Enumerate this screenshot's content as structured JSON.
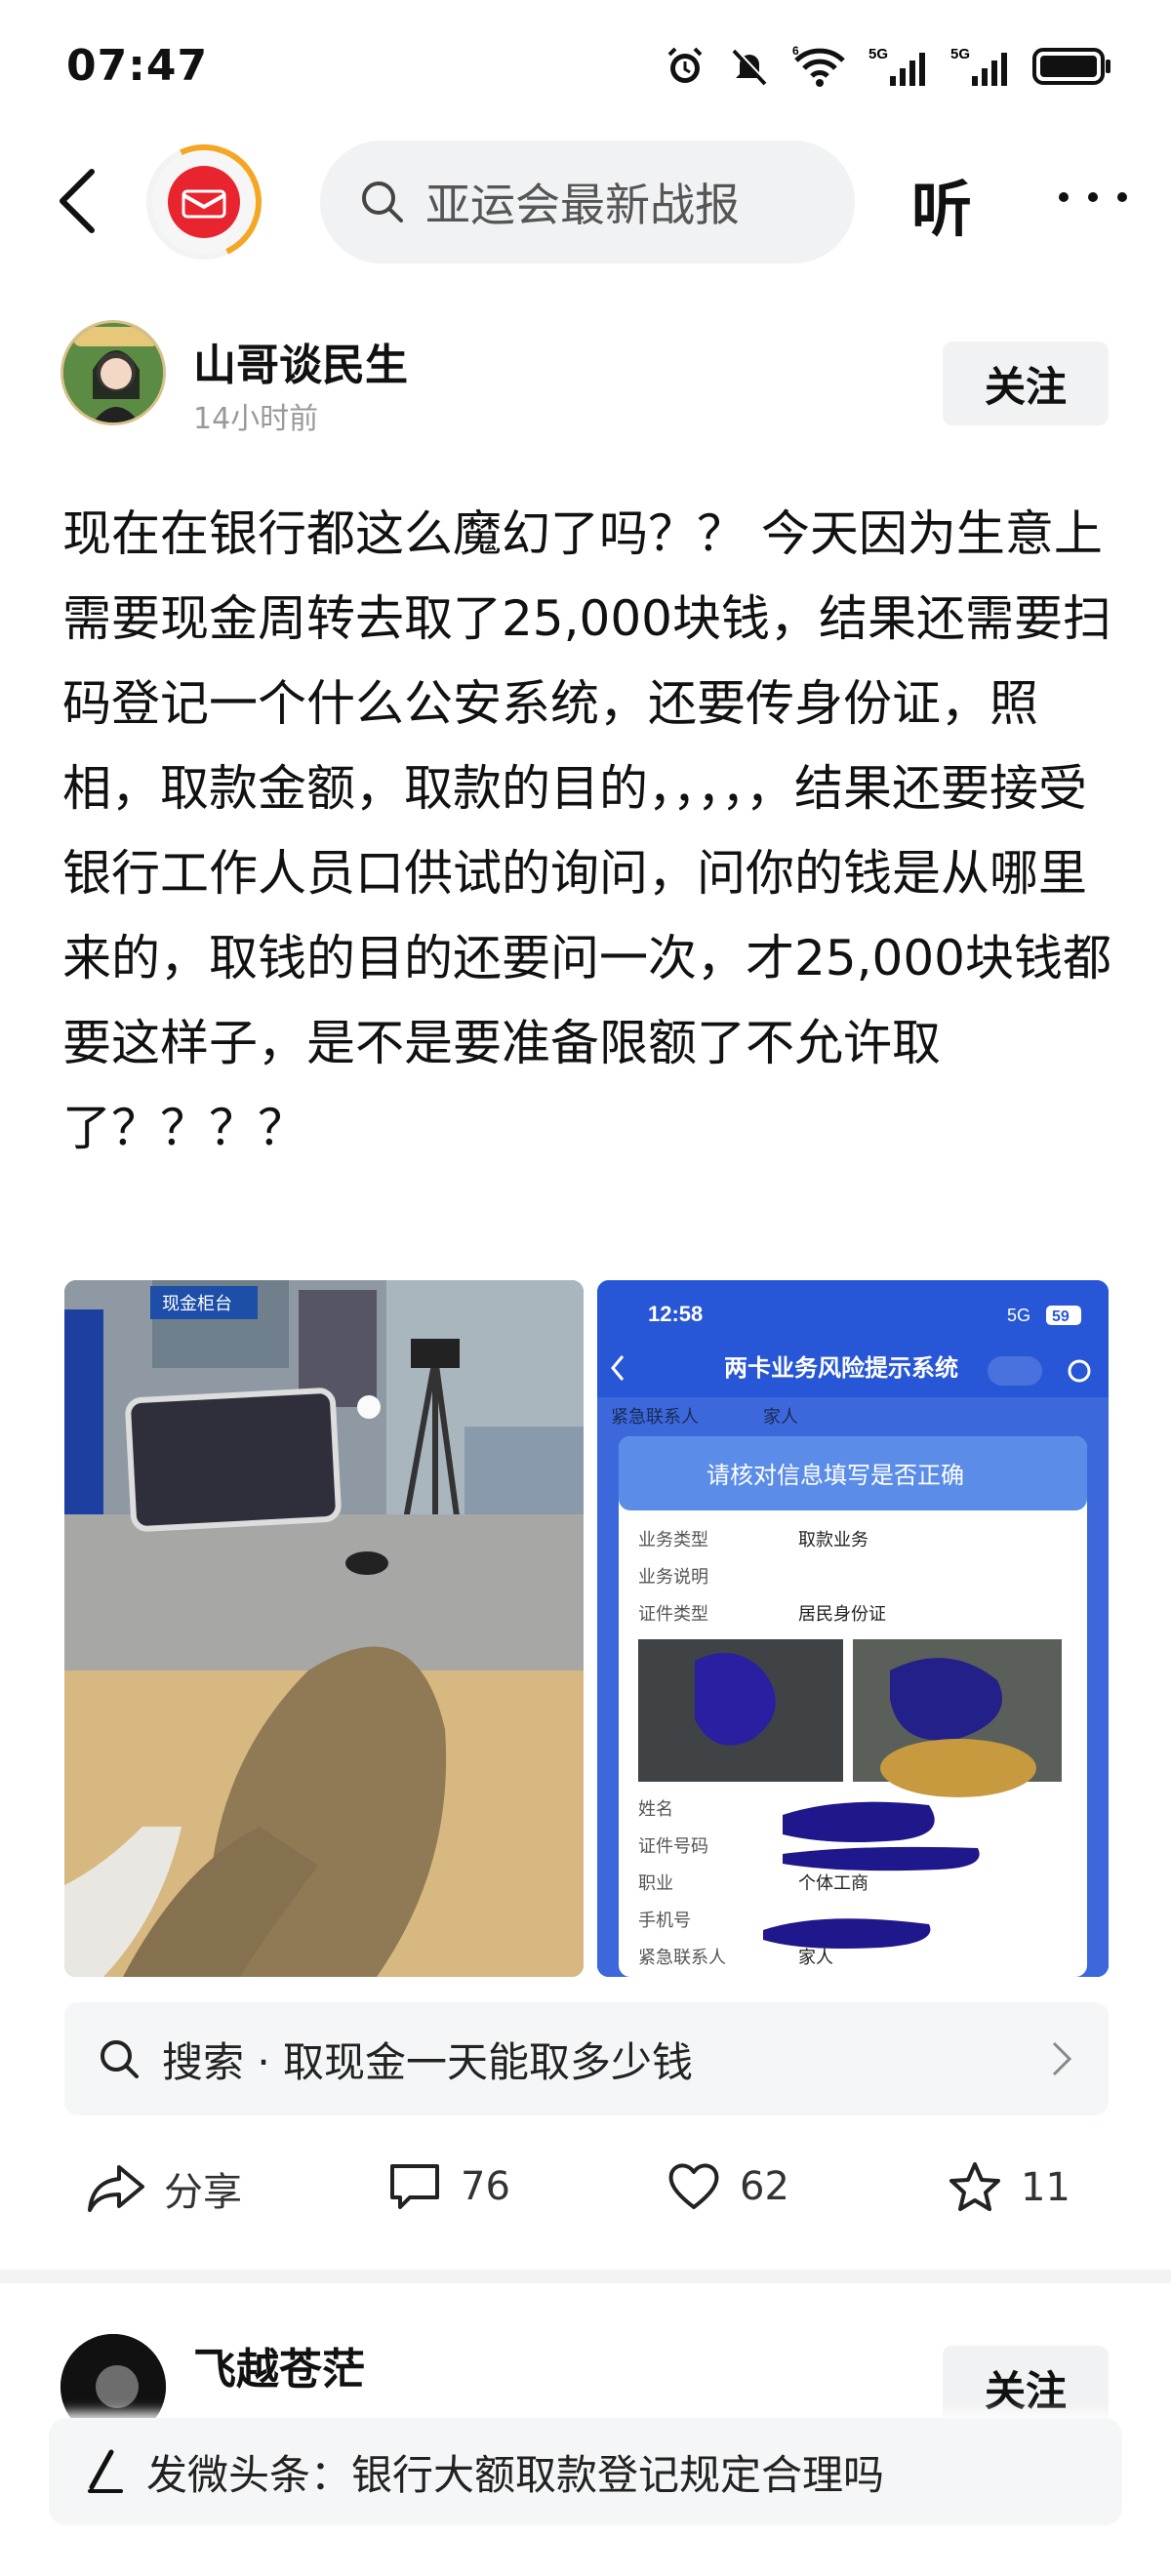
{
  "status_bar": {
    "time": "07:47",
    "icons": [
      "alarm-icon",
      "mute-icon",
      "wifi-icon",
      "signal-5g-icon",
      "signal-5g-icon",
      "battery-icon"
    ],
    "wifi_badge": "6",
    "signal_label_1": "5G",
    "signal_label_2": "5G"
  },
  "nav": {
    "search_placeholder": "亚运会最新战报",
    "listen_label": "听",
    "accent": "#e8242f"
  },
  "post": {
    "author": "山哥谈民生",
    "time": "14小时前",
    "follow_label": "关注",
    "text": "现在在银行都这么魔幻了吗？？ 今天因为生意上需要现金周转去取了25,000块钱，结果还需要扫码登记一个什么公安系统，还要传身份证，照相，取款金额，取款的目的，，，，，结果还要接受银行工作人员口供试的询问，问你的钱是从哪里来的，取钱的目的还要问一次，才25,000块钱都要这样子，是不是要准备限额了不允许取了？？？？"
  },
  "image_left": {
    "sign_text": "现金柜台"
  },
  "image_right": {
    "time": "12:58",
    "status": "5G",
    "battery": "59",
    "title": "两卡业务风险提示系统",
    "row_top_label": "紧急联系人",
    "row_top_value": "家人",
    "banner": "请核对信息填写是否正确",
    "fields": [
      {
        "label": "业务类型",
        "value": "取款业务"
      },
      {
        "label": "业务说明",
        "value": ""
      },
      {
        "label": "证件类型",
        "value": "居民身份证"
      }
    ],
    "fields_bottom": [
      {
        "label": "姓名",
        "value": ""
      },
      {
        "label": "证件号码",
        "value": ""
      },
      {
        "label": "职业",
        "value": "个体工商"
      },
      {
        "label": "手机号",
        "value": ""
      },
      {
        "label": "紧急联系人",
        "value": "家人"
      }
    ]
  },
  "search_suggest": {
    "text": "搜索 · 取现金一天能取多少钱"
  },
  "actions": {
    "share_label": "分享",
    "comment_count": "76",
    "like_count": "62",
    "favorite_count": "11"
  },
  "next_post": {
    "author": "飞越苍茫",
    "follow_label": "关注"
  },
  "compose": {
    "text": "发微头条：银行大额取款登记规定合理吗"
  }
}
